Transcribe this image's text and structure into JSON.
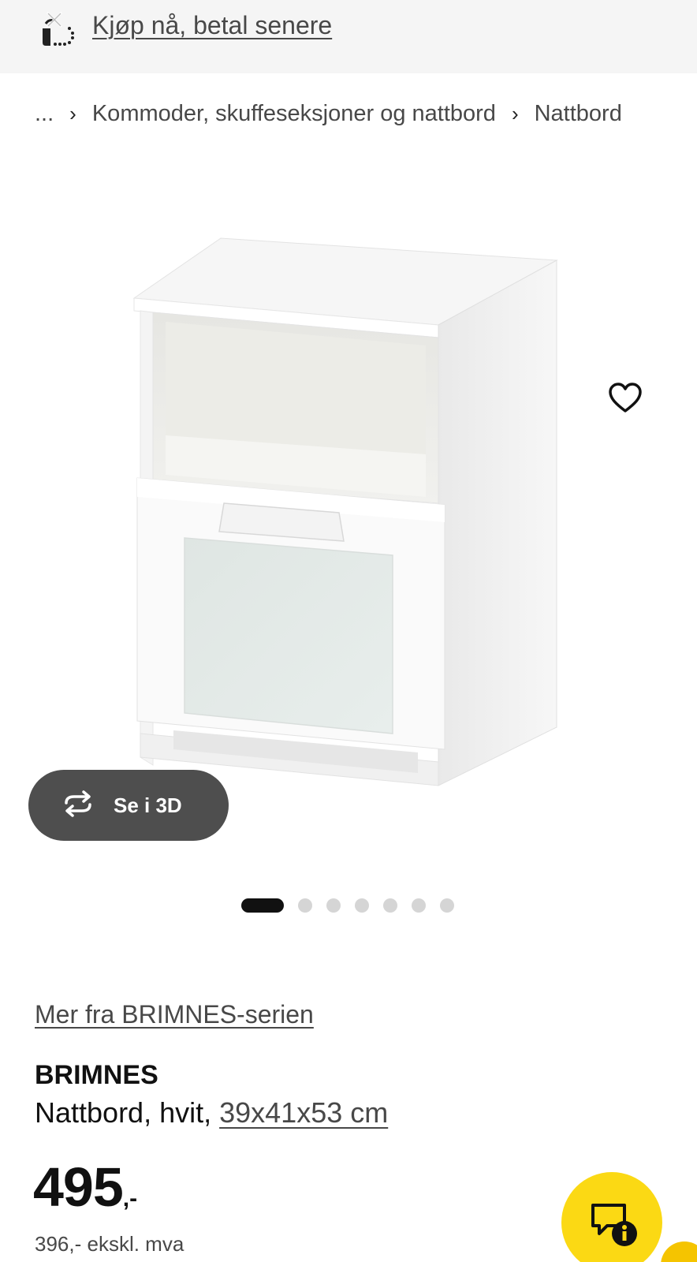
{
  "promo": {
    "link_text": "Kjøp nå, betal senere",
    "icon": "buy-now-pay-later-icon"
  },
  "breadcrumb": {
    "ellipsis": "...",
    "separator": "›",
    "items": [
      {
        "label": "Kommoder, skuffeseksjoner og nattbord"
      },
      {
        "label": "Nattbord"
      }
    ]
  },
  "gallery": {
    "image": "nightstand-product-image",
    "favorite_icon": "heart-icon",
    "view_3d_label": "Se i 3D",
    "view_3d_icon": "rotate-3d-icon",
    "dots_total": 7,
    "dots_active_index": 0
  },
  "product": {
    "series_link": "Mer fra BRIMNES-serien",
    "name": "BRIMNES",
    "description_prefix": "Nattbord, hvit, ",
    "dimensions": "39x41x53 cm",
    "price_integer": "495",
    "price_suffix": ",-",
    "price_ex_vat": "396,- ekskl. mva"
  },
  "colors": {
    "promo_bg": "#f5f5f5",
    "button_3d_bg": "#4e4e4e",
    "chat_yellow": "#fbd914",
    "dot_active": "#111111",
    "dot_inactive": "#d5d5d5"
  },
  "chat": {
    "icon": "chat-info-icon"
  }
}
